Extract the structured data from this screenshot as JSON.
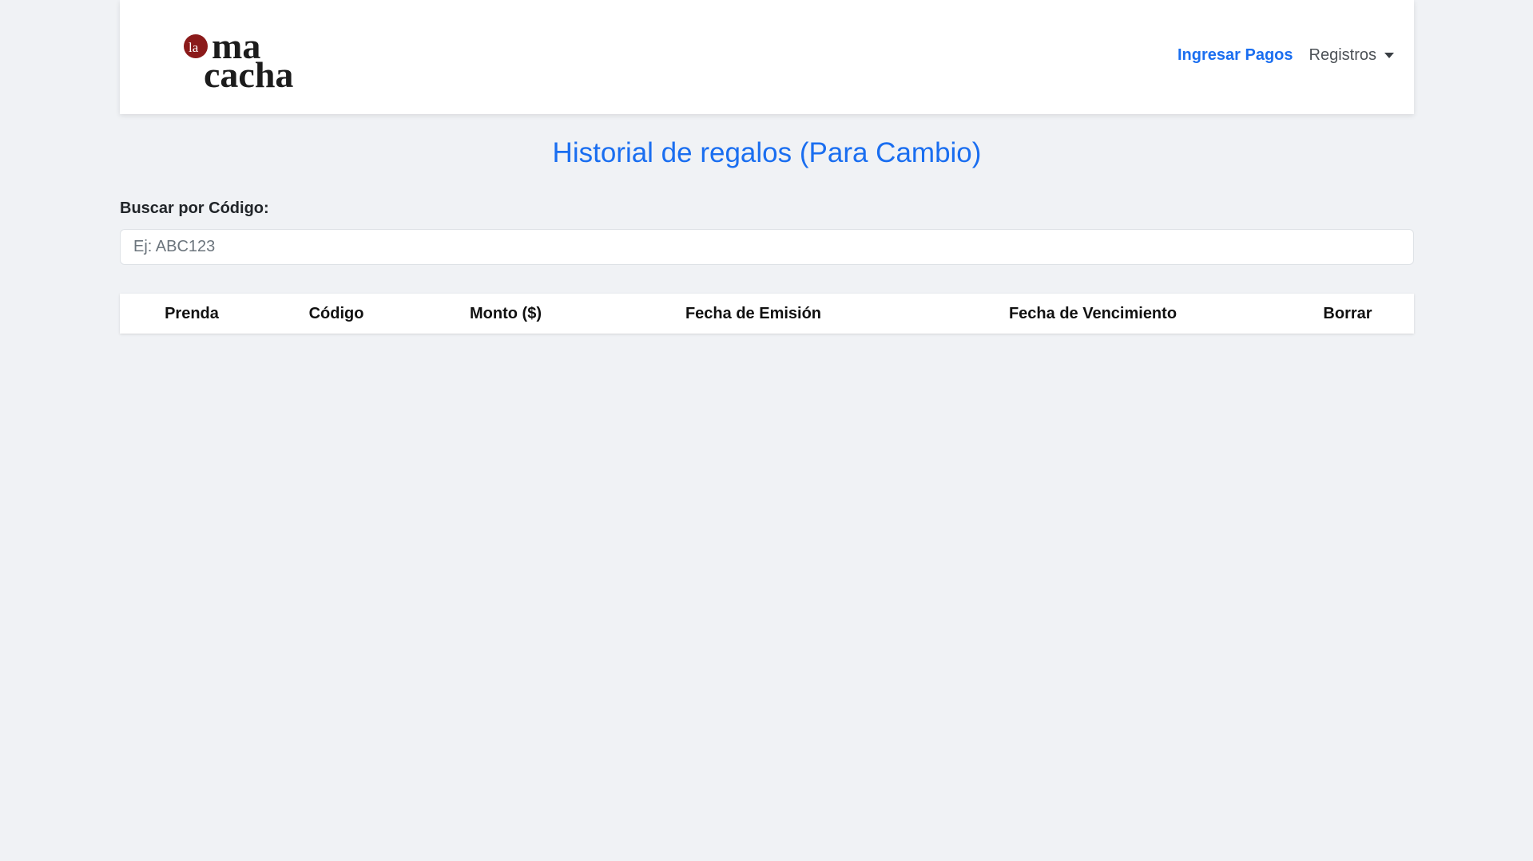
{
  "brand": {
    "logo_prefix": "la",
    "logo_line1": "ma",
    "logo_line2": "cacha",
    "accent_color": "#8b1a1a"
  },
  "nav": {
    "active_link": "Ingresar Pagos",
    "dropdown_label": "Registros"
  },
  "page": {
    "title": "Historial de regalos (Para Cambio)"
  },
  "search": {
    "label": "Buscar por Código:",
    "placeholder": "Ej: ABC123",
    "value": ""
  },
  "table": {
    "headers": [
      "Prenda",
      "Código",
      "Monto ($)",
      "Fecha de Emisión",
      "Fecha de Vencimiento",
      "Borrar"
    ],
    "rows": []
  },
  "colors": {
    "primary": "#1a6ef0",
    "background": "#f0f2f5"
  }
}
